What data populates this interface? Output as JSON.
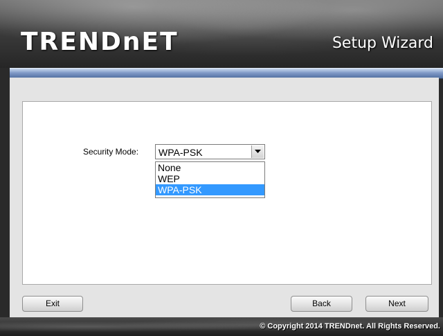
{
  "header": {
    "logo": "TRENDnET",
    "title": "Setup Wizard"
  },
  "form": {
    "security_mode_label": "Security Mode:",
    "security_mode_value": "WPA-PSK",
    "options": [
      "None",
      "WEP",
      "WPA-PSK"
    ],
    "highlighted_option": "WPA-PSK"
  },
  "buttons": {
    "exit": "Exit",
    "back": "Back",
    "next": "Next"
  },
  "footer": {
    "copyright": "© Copyright 2014 TRENDnet. All Rights Reserved."
  },
  "colors": {
    "accent_bar": "#7f99c6",
    "selection": "#3399ff"
  }
}
